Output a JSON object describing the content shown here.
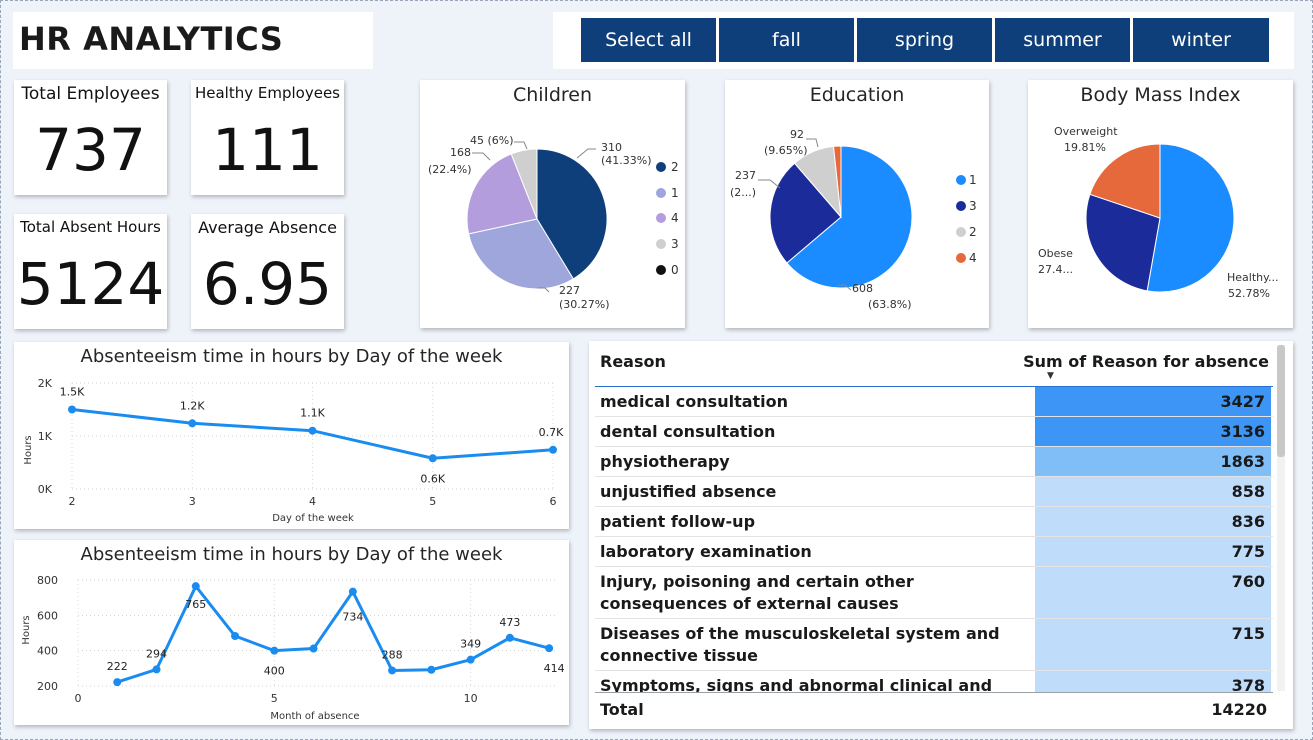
{
  "header": {
    "title": "HR ANALYTICS"
  },
  "season_slicer": {
    "options": [
      "Select all",
      "fall",
      "spring",
      "summer",
      "winter"
    ]
  },
  "kpis": {
    "total_employees": {
      "label": "Total Employees",
      "value": "737"
    },
    "healthy_employees": {
      "label": "Healthy Employees",
      "value": "111"
    },
    "total_absent_hours": {
      "label": "Total Absent Hours",
      "value": "5124"
    },
    "average_absence": {
      "label": "Average Absence",
      "value": "6.95"
    }
  },
  "colors": {
    "navy": "#0f3f7a",
    "lavender_blue": "#9fa6dc",
    "lavender": "#b39ddd",
    "gray": "#cfcfcf",
    "black": "#111111",
    "bright_blue": "#1a8cff",
    "dark_blue": "#1b2b9a",
    "orange": "#e5693a",
    "line_blue": "#1a8cf0",
    "bar_dark": "#3d96f5",
    "bar_mid": "#80bef7",
    "bar_light": "#bfdcfa"
  },
  "chart_data": [
    {
      "type": "pie",
      "title": "Children",
      "slices": [
        {
          "name": "2",
          "value": 310,
          "label": "310",
          "pct": "(41.33%)"
        },
        {
          "name": "1",
          "value": 227,
          "label": "227",
          "pct": "(30.27%)"
        },
        {
          "name": "4",
          "value": 168,
          "label": "168",
          "pct": "(22.4%)"
        },
        {
          "name": "3",
          "value": 45,
          "label": "45 (6%)",
          "pct": ""
        },
        {
          "name": "0",
          "value": 0,
          "label": "",
          "pct": ""
        }
      ],
      "legend": [
        "2",
        "1",
        "4",
        "3",
        "0"
      ],
      "legend_position": "right"
    },
    {
      "type": "pie",
      "title": "Education",
      "slices": [
        {
          "name": "1",
          "value": 608,
          "label": "608",
          "pct": "(63.8%)"
        },
        {
          "name": "3",
          "value": 237,
          "label": "237",
          "pct": "(2...)"
        },
        {
          "name": "2",
          "value": 92,
          "label": "92",
          "pct": "(9.65%)"
        },
        {
          "name": "4",
          "value": 16,
          "label": "",
          "pct": ""
        }
      ],
      "legend": [
        "1",
        "3",
        "2",
        "4"
      ],
      "legend_position": "right"
    },
    {
      "type": "pie",
      "title": "Body Mass Index",
      "slices": [
        {
          "name": "Healthy...",
          "value": 52.78,
          "label": "Healthy...",
          "pct": "52.78%"
        },
        {
          "name": "Obese",
          "value": 27.41,
          "label": "Obese",
          "pct": "27.4..."
        },
        {
          "name": "Overweight",
          "value": 19.81,
          "label": "Overweight",
          "pct": "19.81%"
        }
      ]
    },
    {
      "type": "line",
      "title": "Absenteeism time in hours by Day of the week",
      "xlabel": "Day of the week",
      "ylabel": "Hours",
      "x": [
        2,
        3,
        4,
        5,
        6
      ],
      "y": [
        1500,
        1240,
        1100,
        580,
        740
      ],
      "point_labels": [
        "1.5K",
        "1.2K",
        "1.1K",
        "0.6K",
        "0.7K"
      ],
      "xticks": [
        "2",
        "3",
        "4",
        "5",
        "6"
      ],
      "yticks": [
        0,
        1000,
        2000
      ],
      "ytick_labels": [
        "0K",
        "1K",
        "2K"
      ],
      "ylim": [
        0,
        2000
      ],
      "xlim": [
        2,
        6
      ],
      "grid": true
    },
    {
      "type": "line",
      "title": "Absenteeism time in hours by Day of the week",
      "xlabel": "Month of absence",
      "ylabel": "Hours",
      "x": [
        2,
        3,
        4,
        5,
        6,
        7,
        8,
        9,
        10,
        11,
        12
      ],
      "y": [
        222,
        294,
        765,
        483,
        400,
        412,
        734,
        288,
        292,
        349,
        473,
        414
      ],
      "x_full": [
        1,
        2,
        3,
        4,
        5,
        6,
        7,
        8,
        9,
        10,
        11,
        12
      ],
      "point_labels": [
        "222",
        "294",
        "765",
        "",
        "400",
        "",
        "734",
        "288",
        "",
        "349",
        "473",
        "414"
      ],
      "xticks": [
        "0",
        "5",
        "10"
      ],
      "xtick_values": [
        0,
        5,
        10
      ],
      "yticks": [
        200,
        400,
        600,
        800
      ],
      "ytick_labels": [
        "200",
        "400",
        "600",
        "800"
      ],
      "ylim": [
        200,
        800
      ],
      "xlim": [
        0,
        12.2
      ],
      "grid": true
    },
    {
      "type": "table",
      "columns": [
        "Reason",
        "Sum of Reason for absence"
      ],
      "rows": [
        {
          "reason": "medical consultation",
          "value": "3427",
          "num": 3427
        },
        {
          "reason": "dental consultation",
          "value": "3136",
          "num": 3136
        },
        {
          "reason": "physiotherapy",
          "value": "1863",
          "num": 1863
        },
        {
          "reason": "unjustified absence",
          "value": "858",
          "num": 858
        },
        {
          "reason": "patient follow-up",
          "value": "836",
          "num": 836
        },
        {
          "reason": "laboratory examination",
          "value": "775",
          "num": 775
        },
        {
          "reason": "Injury, poisoning and certain other consequences of external causes",
          "value": "760",
          "num": 760
        },
        {
          "reason": "Diseases of the musculoskeletal system and connective tissue",
          "value": "715",
          "num": 715
        },
        {
          "reason": "Symptoms, signs and abnormal clinical and",
          "value": "378",
          "num": 378
        }
      ],
      "total_label": "Total",
      "total_value": "14220"
    }
  ]
}
